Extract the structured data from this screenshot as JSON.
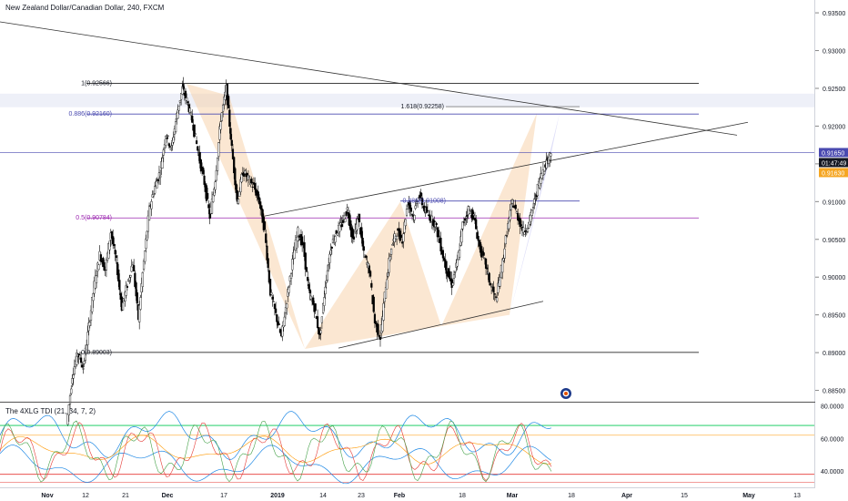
{
  "header": {
    "title": "New Zealand Dollar/Canadian Dollar, 240, FXCM"
  },
  "indicator": {
    "title": "The 4XLG TDI (21, 34, 7, 2)"
  },
  "colors": {
    "fib": "#4a4ab0",
    "fib_mid": "#9c27b0",
    "pattern_fill": "#f7c99c",
    "pattern_fill2": "#b8b8f0",
    "candle": "#000000",
    "price_badge": "#4a4ab0",
    "timer_badge": "#131722",
    "orange_badge": "#f5a623"
  },
  "chart_data": [
    {
      "type": "line",
      "title": "New Zealand Dollar/Canadian Dollar, 240, FXCM",
      "y_ticks": [
        "0.93500",
        "0.93000",
        "0.92500",
        "0.92000",
        "0.91500",
        "0.91000",
        "0.90500",
        "0.90000",
        "0.89500",
        "0.89000",
        "0.88500"
      ],
      "ylim": [
        0.8835,
        0.9367
      ],
      "x_ticks": [
        "Nov",
        "12",
        "21",
        "Dec",
        "17",
        "2019",
        "14",
        "23",
        "Feb",
        "18",
        "Mar",
        "18",
        "Apr",
        "15",
        "May",
        "13"
      ],
      "current_price": "0.91650",
      "countdown": "01:47:49",
      "orange_price": "0.91630",
      "fib_labels": {
        "level_1": "1(0.92566)",
        "level_0886": "0.886(0.92160)",
        "level_05": "0.5(0.90784)",
        "level_0": "0(0.89003)",
        "ext_1618": "1.618(0.92258)",
        "level_0886b": "0.886(0.91008)"
      },
      "fib_values": {
        "level_1": 0.92566,
        "level_0886": 0.9216,
        "level_05": 0.90784,
        "level_0": 0.89003,
        "ext_1618": 0.92258,
        "level_0886b": 0.91008
      },
      "close_series": [
        0.8805,
        0.887,
        0.89,
        0.888,
        0.8935,
        0.899,
        0.903,
        0.901,
        0.906,
        0.902,
        0.896,
        0.899,
        0.902,
        0.8945,
        0.902,
        0.909,
        0.912,
        0.914,
        0.919,
        0.917,
        0.9215,
        0.925,
        0.923,
        0.92,
        0.916,
        0.9125,
        0.908,
        0.913,
        0.921,
        0.925,
        0.917,
        0.91,
        0.914,
        0.913,
        0.912,
        0.91,
        0.906,
        0.898,
        0.895,
        0.892,
        0.897,
        0.902,
        0.906,
        0.904,
        0.898,
        0.896,
        0.892,
        0.899,
        0.904,
        0.906,
        0.907,
        0.909,
        0.905,
        0.908,
        0.903,
        0.901,
        0.894,
        0.892,
        0.899,
        0.904,
        0.906,
        0.905,
        0.91,
        0.908,
        0.911,
        0.909,
        0.908,
        0.907,
        0.904,
        0.901,
        0.899,
        0.902,
        0.907,
        0.909,
        0.908,
        0.904,
        0.902,
        0.899,
        0.897,
        0.901,
        0.906,
        0.91,
        0.908,
        0.906,
        0.907,
        0.91,
        0.913,
        0.915,
        0.9165
      ]
    },
    {
      "type": "line",
      "title": "The 4XLG TDI (21, 34, 7, 2)",
      "y_ticks": [
        "80.0000",
        "60.0000",
        "40.0000"
      ],
      "ylim": [
        30,
        82
      ],
      "levels": [
        68,
        62,
        38
      ]
    }
  ]
}
